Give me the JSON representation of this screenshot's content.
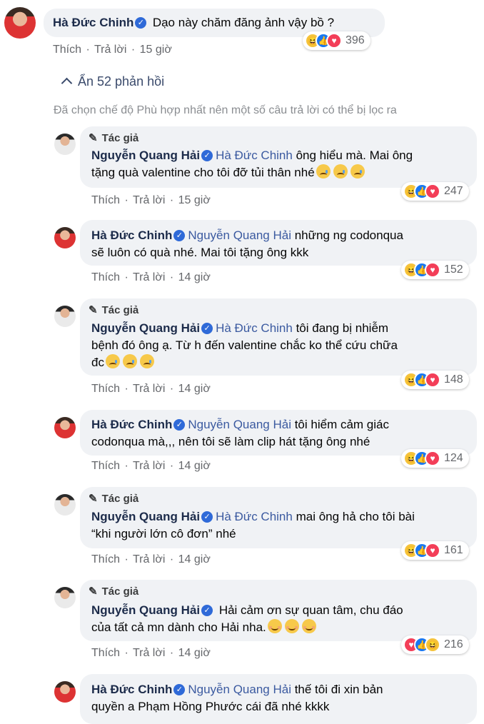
{
  "top_comment": {
    "author": "Hà Đức Chinh",
    "text": "Dạo này chăm đăng ảnh vậy bồ ?",
    "like_label": "Thích",
    "reply_label": "Trả lời",
    "time": "15 giờ",
    "reactions": {
      "types": [
        "haha",
        "like",
        "love"
      ],
      "count": "396"
    }
  },
  "hide_replies_label": "Ẩn 52 phản hồi",
  "filter_notice": "Đã chọn chế độ Phù hợp nhất nên một số câu trả lời có thể bị lọc ra",
  "author_badge": "Tác giả",
  "replies": [
    {
      "author": "Nguyễn Quang Hải",
      "mention": "Hà Đức Chinh",
      "lines": [
        "ông hiểu mà. Mai ông",
        "tặng quà valentine cho tôi đỡ tủi thân nhé"
      ],
      "emoji": "sad",
      "emoji_count": 3,
      "time": "15 giờ",
      "count": "247",
      "reactions": [
        "haha",
        "like",
        "love"
      ]
    },
    {
      "author": "Hà Đức Chinh",
      "mention": "Nguyễn Quang Hải",
      "lines": [
        "những ng codonqua",
        "sẽ luôn có quà nhé. Mai tôi tặng ông kkk"
      ],
      "time": "14 giờ",
      "count": "152",
      "reactions": [
        "haha",
        "like",
        "love"
      ]
    },
    {
      "author": "Nguyễn Quang Hải",
      "mention": "Hà Đức Chinh",
      "lines": [
        "tôi đang bị nhiễm",
        "bệnh đó ông ạ. Từ h đến valentine chắc ko thể cứu chữa",
        "đc"
      ],
      "emoji": "sad",
      "emoji_count": 3,
      "time": "14 giờ",
      "count": "148",
      "reactions": [
        "haha",
        "like",
        "love"
      ]
    },
    {
      "author": "Hà Đức Chinh",
      "mention": "Nguyễn Quang Hải",
      "lines": [
        "tôi hiểm cảm giác",
        "codonqua mà,,, nên tôi sẽ làm clip hát tặng ông nhé"
      ],
      "time": "14 giờ",
      "count": "124",
      "reactions": [
        "haha",
        "like",
        "love"
      ]
    },
    {
      "author": "Nguyễn Quang Hải",
      "mention": "Hà Đức Chinh",
      "lines": [
        "mai ông hả cho tôi bài",
        "“khi người lớn cô đơn” nhé"
      ],
      "time": "14 giờ",
      "count": "161",
      "reactions": [
        "haha",
        "like",
        "love"
      ]
    },
    {
      "author": "Nguyễn Quang Hải",
      "mention": "",
      "lines": [
        "Hải cảm ơn sự quan tâm, chu đáo",
        "của tất cả mn dành cho Hải nha."
      ],
      "emoji": "blush",
      "emoji_count": 3,
      "time": "14 giờ",
      "count": "216",
      "reactions": [
        "love",
        "like",
        "haha"
      ]
    },
    {
      "author": "Hà Đức Chinh",
      "mention": "Nguyễn Quang Hải",
      "lines": [
        "thế tôi đi xin bản",
        "quyền a Phạm Hồng Phước cái đã nhé kkkk"
      ]
    }
  ],
  "action_labels": {
    "like": "Thích",
    "reply": "Trả lời",
    "sep": "·"
  }
}
